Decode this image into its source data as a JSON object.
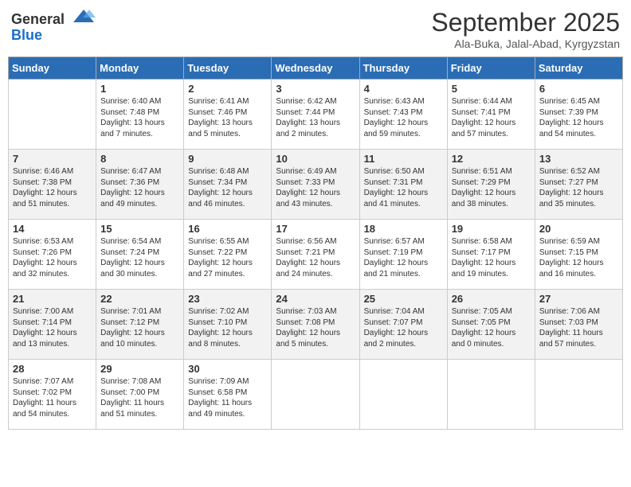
{
  "header": {
    "logo_general": "General",
    "logo_blue": "Blue",
    "month_title": "September 2025",
    "location": "Ala-Buka, Jalal-Abad, Kyrgyzstan"
  },
  "weekdays": [
    "Sunday",
    "Monday",
    "Tuesday",
    "Wednesday",
    "Thursday",
    "Friday",
    "Saturday"
  ],
  "weeks": [
    [
      {
        "day": "",
        "sunrise": "",
        "sunset": "",
        "daylight": ""
      },
      {
        "day": "1",
        "sunrise": "Sunrise: 6:40 AM",
        "sunset": "Sunset: 7:48 PM",
        "daylight": "Daylight: 13 hours and 7 minutes."
      },
      {
        "day": "2",
        "sunrise": "Sunrise: 6:41 AM",
        "sunset": "Sunset: 7:46 PM",
        "daylight": "Daylight: 13 hours and 5 minutes."
      },
      {
        "day": "3",
        "sunrise": "Sunrise: 6:42 AM",
        "sunset": "Sunset: 7:44 PM",
        "daylight": "Daylight: 13 hours and 2 minutes."
      },
      {
        "day": "4",
        "sunrise": "Sunrise: 6:43 AM",
        "sunset": "Sunset: 7:43 PM",
        "daylight": "Daylight: 12 hours and 59 minutes."
      },
      {
        "day": "5",
        "sunrise": "Sunrise: 6:44 AM",
        "sunset": "Sunset: 7:41 PM",
        "daylight": "Daylight: 12 hours and 57 minutes."
      },
      {
        "day": "6",
        "sunrise": "Sunrise: 6:45 AM",
        "sunset": "Sunset: 7:39 PM",
        "daylight": "Daylight: 12 hours and 54 minutes."
      }
    ],
    [
      {
        "day": "7",
        "sunrise": "Sunrise: 6:46 AM",
        "sunset": "Sunset: 7:38 PM",
        "daylight": "Daylight: 12 hours and 51 minutes."
      },
      {
        "day": "8",
        "sunrise": "Sunrise: 6:47 AM",
        "sunset": "Sunset: 7:36 PM",
        "daylight": "Daylight: 12 hours and 49 minutes."
      },
      {
        "day": "9",
        "sunrise": "Sunrise: 6:48 AM",
        "sunset": "Sunset: 7:34 PM",
        "daylight": "Daylight: 12 hours and 46 minutes."
      },
      {
        "day": "10",
        "sunrise": "Sunrise: 6:49 AM",
        "sunset": "Sunset: 7:33 PM",
        "daylight": "Daylight: 12 hours and 43 minutes."
      },
      {
        "day": "11",
        "sunrise": "Sunrise: 6:50 AM",
        "sunset": "Sunset: 7:31 PM",
        "daylight": "Daylight: 12 hours and 41 minutes."
      },
      {
        "day": "12",
        "sunrise": "Sunrise: 6:51 AM",
        "sunset": "Sunset: 7:29 PM",
        "daylight": "Daylight: 12 hours and 38 minutes."
      },
      {
        "day": "13",
        "sunrise": "Sunrise: 6:52 AM",
        "sunset": "Sunset: 7:27 PM",
        "daylight": "Daylight: 12 hours and 35 minutes."
      }
    ],
    [
      {
        "day": "14",
        "sunrise": "Sunrise: 6:53 AM",
        "sunset": "Sunset: 7:26 PM",
        "daylight": "Daylight: 12 hours and 32 minutes."
      },
      {
        "day": "15",
        "sunrise": "Sunrise: 6:54 AM",
        "sunset": "Sunset: 7:24 PM",
        "daylight": "Daylight: 12 hours and 30 minutes."
      },
      {
        "day": "16",
        "sunrise": "Sunrise: 6:55 AM",
        "sunset": "Sunset: 7:22 PM",
        "daylight": "Daylight: 12 hours and 27 minutes."
      },
      {
        "day": "17",
        "sunrise": "Sunrise: 6:56 AM",
        "sunset": "Sunset: 7:21 PM",
        "daylight": "Daylight: 12 hours and 24 minutes."
      },
      {
        "day": "18",
        "sunrise": "Sunrise: 6:57 AM",
        "sunset": "Sunset: 7:19 PM",
        "daylight": "Daylight: 12 hours and 21 minutes."
      },
      {
        "day": "19",
        "sunrise": "Sunrise: 6:58 AM",
        "sunset": "Sunset: 7:17 PM",
        "daylight": "Daylight: 12 hours and 19 minutes."
      },
      {
        "day": "20",
        "sunrise": "Sunrise: 6:59 AM",
        "sunset": "Sunset: 7:15 PM",
        "daylight": "Daylight: 12 hours and 16 minutes."
      }
    ],
    [
      {
        "day": "21",
        "sunrise": "Sunrise: 7:00 AM",
        "sunset": "Sunset: 7:14 PM",
        "daylight": "Daylight: 12 hours and 13 minutes."
      },
      {
        "day": "22",
        "sunrise": "Sunrise: 7:01 AM",
        "sunset": "Sunset: 7:12 PM",
        "daylight": "Daylight: 12 hours and 10 minutes."
      },
      {
        "day": "23",
        "sunrise": "Sunrise: 7:02 AM",
        "sunset": "Sunset: 7:10 PM",
        "daylight": "Daylight: 12 hours and 8 minutes."
      },
      {
        "day": "24",
        "sunrise": "Sunrise: 7:03 AM",
        "sunset": "Sunset: 7:08 PM",
        "daylight": "Daylight: 12 hours and 5 minutes."
      },
      {
        "day": "25",
        "sunrise": "Sunrise: 7:04 AM",
        "sunset": "Sunset: 7:07 PM",
        "daylight": "Daylight: 12 hours and 2 minutes."
      },
      {
        "day": "26",
        "sunrise": "Sunrise: 7:05 AM",
        "sunset": "Sunset: 7:05 PM",
        "daylight": "Daylight: 12 hours and 0 minutes."
      },
      {
        "day": "27",
        "sunrise": "Sunrise: 7:06 AM",
        "sunset": "Sunset: 7:03 PM",
        "daylight": "Daylight: 11 hours and 57 minutes."
      }
    ],
    [
      {
        "day": "28",
        "sunrise": "Sunrise: 7:07 AM",
        "sunset": "Sunset: 7:02 PM",
        "daylight": "Daylight: 11 hours and 54 minutes."
      },
      {
        "day": "29",
        "sunrise": "Sunrise: 7:08 AM",
        "sunset": "Sunset: 7:00 PM",
        "daylight": "Daylight: 11 hours and 51 minutes."
      },
      {
        "day": "30",
        "sunrise": "Sunrise: 7:09 AM",
        "sunset": "Sunset: 6:58 PM",
        "daylight": "Daylight: 11 hours and 49 minutes."
      },
      {
        "day": "",
        "sunrise": "",
        "sunset": "",
        "daylight": ""
      },
      {
        "day": "",
        "sunrise": "",
        "sunset": "",
        "daylight": ""
      },
      {
        "day": "",
        "sunrise": "",
        "sunset": "",
        "daylight": ""
      },
      {
        "day": "",
        "sunrise": "",
        "sunset": "",
        "daylight": ""
      }
    ]
  ]
}
